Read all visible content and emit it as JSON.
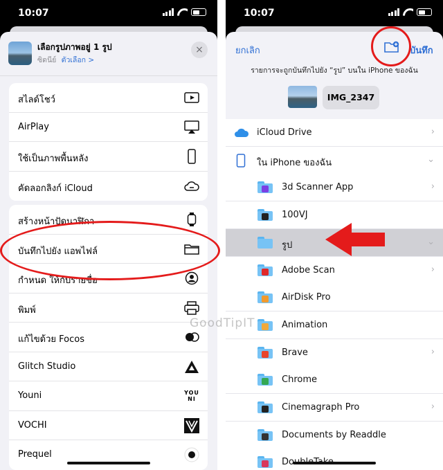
{
  "left_phone": {
    "status": {
      "time": "10:07"
    },
    "sheet": {
      "title": "เลือกรูปภาพอยู่ 1 รูป",
      "subtitle": "ซิดนีย์",
      "options_link": "ตัวเลือก >",
      "close_icon": "×"
    },
    "group1": [
      {
        "label": "สไลด์โชว์",
        "icon": "play-icon"
      },
      {
        "label": "AirPlay",
        "icon": "airplay-icon"
      },
      {
        "label": "ใช้เป็นภาพพื้นหลัง",
        "icon": "phone-icon"
      },
      {
        "label": "คัดลอกลิงก์ iCloud",
        "icon": "cloud-link-icon"
      }
    ],
    "group2": [
      {
        "label": "สร้างหน้าปัดนาฬิกา",
        "icon": "watch-icon"
      },
      {
        "label": "บันทึกไปยัง แอพไฟล์",
        "icon": "folder-icon"
      },
      {
        "label": "กำหนด ให้กับรายชื่อ",
        "icon": "person-icon"
      },
      {
        "label": "พิมพ์",
        "icon": "printer-icon"
      },
      {
        "label": "แก้ไขด้วย Focos",
        "icon": "focos-icon"
      },
      {
        "label": "Glitch Studio",
        "icon": "glitch-icon"
      },
      {
        "label": "Youni",
        "icon": "youni-icon",
        "icon_text": "YOU NI"
      },
      {
        "label": "VOCHI",
        "icon": "vochi-icon"
      },
      {
        "label": "Prequel",
        "icon": "prequel-icon"
      }
    ]
  },
  "right_phone": {
    "status": {
      "time": "10:07"
    },
    "header": {
      "cancel": "ยกเลิก",
      "save": "บันทึก",
      "message": "รายการจะถูกบันทึกไปยัง “รูป” บนใน iPhone ของฉัน",
      "file_name": "IMG_2347"
    },
    "locations": [
      {
        "label": "iCloud Drive",
        "level": 0,
        "icon": "icloud-icon",
        "chevron": "›"
      },
      {
        "label": "ใน iPhone ของฉัน",
        "level": 0,
        "icon": "iphone-icon",
        "chevron": "⌄"
      },
      {
        "label": "3d Scanner App",
        "level": 1,
        "icon": "folder-icon",
        "badge": "#7b3fe4",
        "chevron": "›"
      },
      {
        "label": "100VJ",
        "level": 1,
        "icon": "folder-icon",
        "badge": "#222222"
      },
      {
        "label": "รูป",
        "level": 1,
        "icon": "folder-icon",
        "chevron": "⌄",
        "selected": true
      },
      {
        "label": "Adobe Scan",
        "level": 1,
        "icon": "folder-icon",
        "badge": "#e02828",
        "chevron": "›"
      },
      {
        "label": "AirDisk Pro",
        "level": 1,
        "icon": "folder-icon",
        "badge": "#f29a2e"
      },
      {
        "label": "Animation",
        "level": 1,
        "icon": "folder-icon",
        "badge": "#f2a93b"
      },
      {
        "label": "Brave",
        "level": 1,
        "icon": "folder-icon",
        "badge": "#e8452c",
        "chevron": "›"
      },
      {
        "label": "Chrome",
        "level": 1,
        "icon": "folder-icon",
        "badge": "#34a853"
      },
      {
        "label": "Cinemagraph Pro",
        "level": 1,
        "icon": "folder-icon",
        "badge": "#222222",
        "chevron": "›"
      },
      {
        "label": "Documents by Readdle",
        "level": 1,
        "icon": "folder-icon",
        "badge": "#333333"
      },
      {
        "label": "DoubleTake",
        "level": 1,
        "icon": "folder-icon",
        "badge": "#d8365b"
      }
    ]
  },
  "watermark": "GoodTipIT",
  "colors": {
    "accent": "#2f6fd4",
    "annotation": "#e41b1b"
  }
}
